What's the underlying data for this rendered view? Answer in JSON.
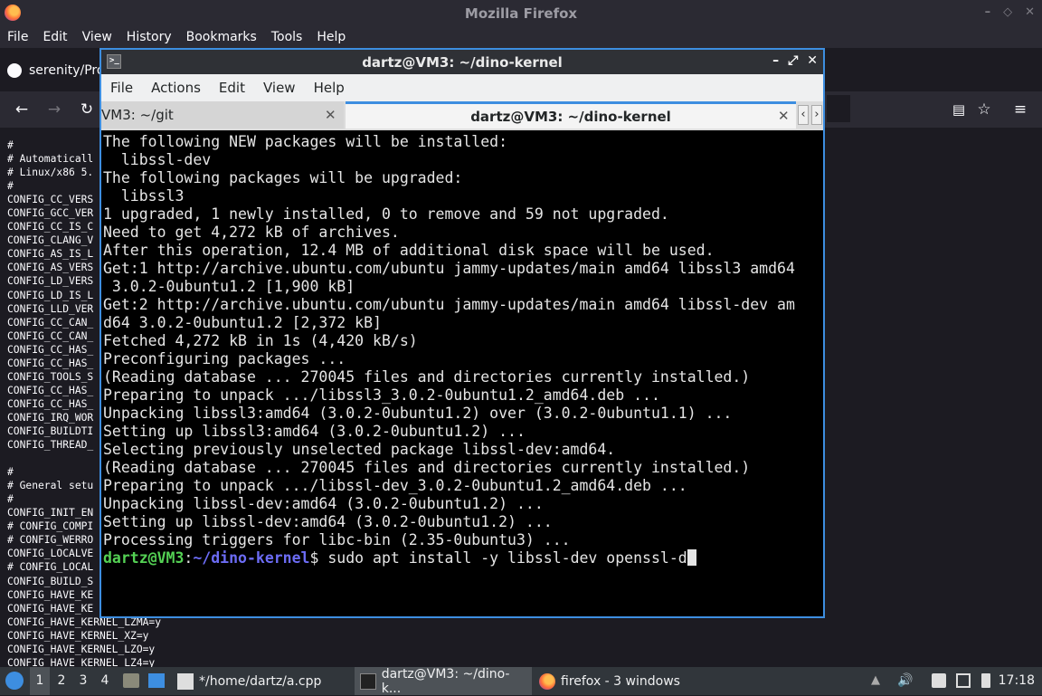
{
  "firefox": {
    "title": "Mozilla Firefox",
    "menu": [
      "File",
      "Edit",
      "View",
      "History",
      "Bookmarks",
      "Tools",
      "Help"
    ],
    "tab_label": "serenity/Pro",
    "content_lines": [
      "#",
      "# Automaticall",
      "# Linux/x86 5.",
      "#",
      "CONFIG_CC_VERS",
      "CONFIG_GCC_VER",
      "CONFIG_CC_IS_C",
      "CONFIG_CLANG_V",
      "CONFIG_AS_IS_L",
      "CONFIG_AS_VERS",
      "CONFIG_LD_VERS",
      "CONFIG_LD_IS_L",
      "CONFIG_LLD_VER",
      "CONFIG_CC_CAN_",
      "CONFIG_CC_CAN_",
      "CONFIG_CC_HAS_",
      "CONFIG_CC_HAS_",
      "CONFIG_TOOLS_S",
      "CONFIG_CC_HAS_",
      "CONFIG_CC_HAS_",
      "CONFIG_IRQ_WOR",
      "CONFIG_BUILDTI",
      "CONFIG_THREAD_",
      "",
      "#",
      "# General setu",
      "#",
      "CONFIG_INIT_EN",
      "# CONFIG_COMPI",
      "# CONFIG_WERRO",
      "CONFIG_LOCALVE",
      "# CONFIG_LOCAL",
      "CONFIG_BUILD_S",
      "CONFIG_HAVE_KE",
      "CONFIG_HAVE_KE",
      "CONFIG_HAVE_KERNEL_LZMA=y",
      "CONFIG_HAVE_KERNEL_XZ=y",
      "CONFIG_HAVE_KERNEL_LZO=y",
      "CONFIG_HAVE_KERNEL_LZ4=y"
    ]
  },
  "terminal": {
    "title": "dartz@VM3: ~/dino-kernel",
    "menu": [
      "File",
      "Actions",
      "Edit",
      "View",
      "Help"
    ],
    "tabs": [
      {
        "label": "VM3: ~/git"
      },
      {
        "label": "dartz@VM3: ~/dino-kernel"
      }
    ],
    "lines": [
      "The following NEW packages will be installed:",
      "  libssl-dev",
      "The following packages will be upgraded:",
      "  libssl3",
      "1 upgraded, 1 newly installed, 0 to remove and 59 not upgraded.",
      "Need to get 4,272 kB of archives.",
      "After this operation, 12.4 MB of additional disk space will be used.",
      "Get:1 http://archive.ubuntu.com/ubuntu jammy-updates/main amd64 libssl3 amd64",
      " 3.0.2-0ubuntu1.2 [1,900 kB]",
      "Get:2 http://archive.ubuntu.com/ubuntu jammy-updates/main amd64 libssl-dev am",
      "d64 3.0.2-0ubuntu1.2 [2,372 kB]",
      "Fetched 4,272 kB in 1s (4,420 kB/s)",
      "Preconfiguring packages ...",
      "(Reading database ... 270045 files and directories currently installed.)",
      "Preparing to unpack .../libssl3_3.0.2-0ubuntu1.2_amd64.deb ...",
      "Unpacking libssl3:amd64 (3.0.2-0ubuntu1.2) over (3.0.2-0ubuntu1.1) ...",
      "Setting up libssl3:amd64 (3.0.2-0ubuntu1.2) ...",
      "Selecting previously unselected package libssl-dev:amd64.",
      "(Reading database ... 270045 files and directories currently installed.)",
      "Preparing to unpack .../libssl-dev_3.0.2-0ubuntu1.2_amd64.deb ...",
      "Unpacking libssl-dev:amd64 (3.0.2-0ubuntu1.2) ...",
      "Setting up libssl-dev:amd64 (3.0.2-0ubuntu1.2) ...",
      "Processing triggers for libc-bin (2.35-0ubuntu3) ..."
    ],
    "prompt": {
      "user": "dartz@VM3",
      "sep": ":",
      "path": "~/dino-kernel",
      "symbol": "$",
      "command": " sudo apt install -y libssl-dev openssl-d"
    }
  },
  "taskbar": {
    "workspaces": [
      "1",
      "2",
      "3",
      "4"
    ],
    "tasks": [
      {
        "label": "*/home/dartz/a.cpp",
        "icon": "text-editor-icon"
      },
      {
        "label": "dartz@VM3: ~/dino-k...",
        "icon": "terminal-icon"
      },
      {
        "label": "firefox - 3 windows",
        "icon": "firefox-icon"
      }
    ],
    "clock": "17:18"
  },
  "colors": {
    "accent": "#3d8ee0",
    "prompt_user": "#54d154",
    "prompt_path": "#6c6cf5"
  }
}
